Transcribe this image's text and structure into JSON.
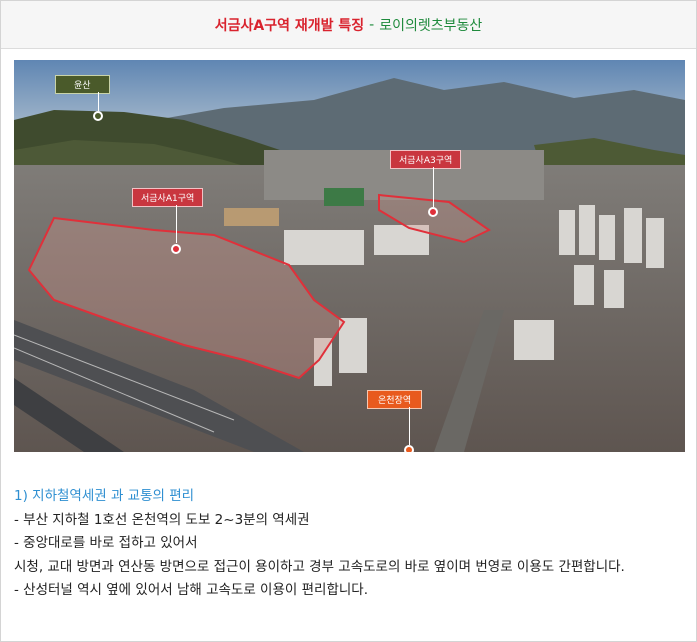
{
  "header": {
    "title": "서금사A구역 재개발 특징",
    "separator": "-",
    "subtitle": "로이의렛츠부동산"
  },
  "photo": {
    "labels": {
      "mountain": "윤산",
      "zone_a1": "서금사A1구역",
      "zone_a3": "서금사A3구역",
      "station": "온천장역"
    },
    "colors": {
      "mountain_tag": "#4a5a2a",
      "zone_tag": "#c9363f",
      "station_tag": "#e85a1e",
      "zone_outline": "#e0303a"
    }
  },
  "content": {
    "heading": "1) 지하철역세권 과 교통의 편리",
    "lines": [
      "- 부산 지하철 1호선 온천역의 도보 2~3분의 역세권",
      "- 중앙대로를 바로 접하고 있어서",
      "시청, 교대 방면과 연산동 방면으로 접근이 용이하고 경부 고속도로의 바로 옆이며 번영로 이용도 간편합니다.",
      "- 산성터널 역시 옆에 있어서 남해 고속도로 이용이 편리합니다."
    ]
  }
}
